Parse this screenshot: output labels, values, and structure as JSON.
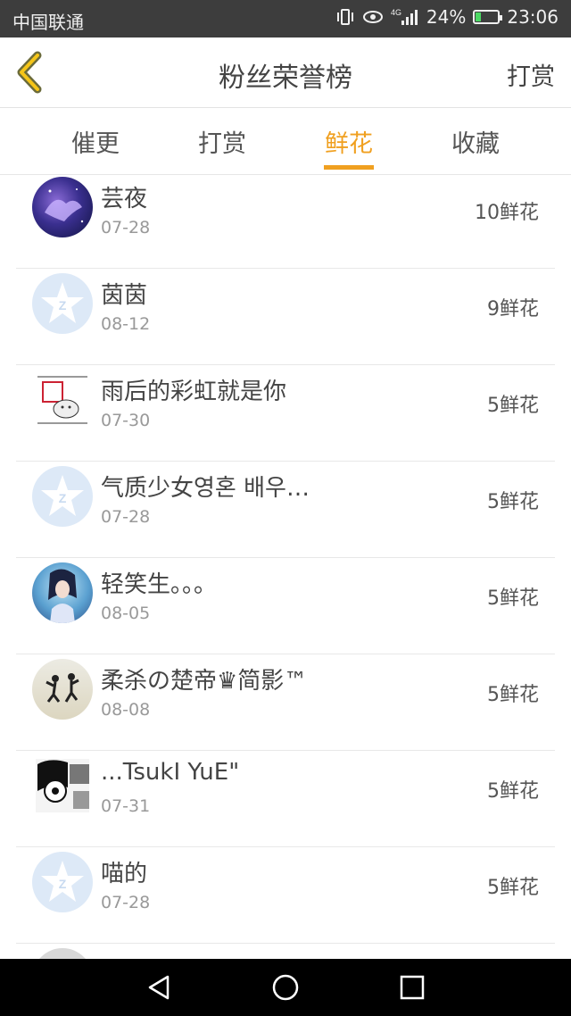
{
  "status_bar": {
    "carrier": "中国联通",
    "network": "4G",
    "battery": "24%",
    "battery_level": 0.24,
    "time": "23:06"
  },
  "header": {
    "title": "粉丝荣誉榜",
    "action": "打赏"
  },
  "tabs": [
    {
      "label": "催更"
    },
    {
      "label": "打赏"
    },
    {
      "label": "鲜花"
    },
    {
      "label": "收藏"
    }
  ],
  "active_tab": "鲜花",
  "entries": [
    {
      "name": "芸夜",
      "date": "07-28",
      "count": "10鲜花"
    },
    {
      "name": "茵茵",
      "date": "08-12",
      "count": "9鲜花"
    },
    {
      "name": "雨后的彩虹就是你",
      "date": "07-30",
      "count": "5鲜花"
    },
    {
      "name": "气质少女영혼 배우…",
      "date": "07-28",
      "count": "5鲜花"
    },
    {
      "name": "轻笑生。。。",
      "date": "08-05",
      "count": "5鲜花"
    },
    {
      "name": "柔杀の楚帝♛简影™",
      "date": "08-08",
      "count": "5鲜花"
    },
    {
      "name": "...TsukI YuE\"",
      "date": "07-31",
      "count": "5鲜花"
    },
    {
      "name": "喵的",
      "date": "07-28",
      "count": "5鲜花"
    }
  ],
  "colors": {
    "accent": "#f0a020",
    "status_bar_bg": "#3d3d3d",
    "divider": "#e8e8e8"
  }
}
